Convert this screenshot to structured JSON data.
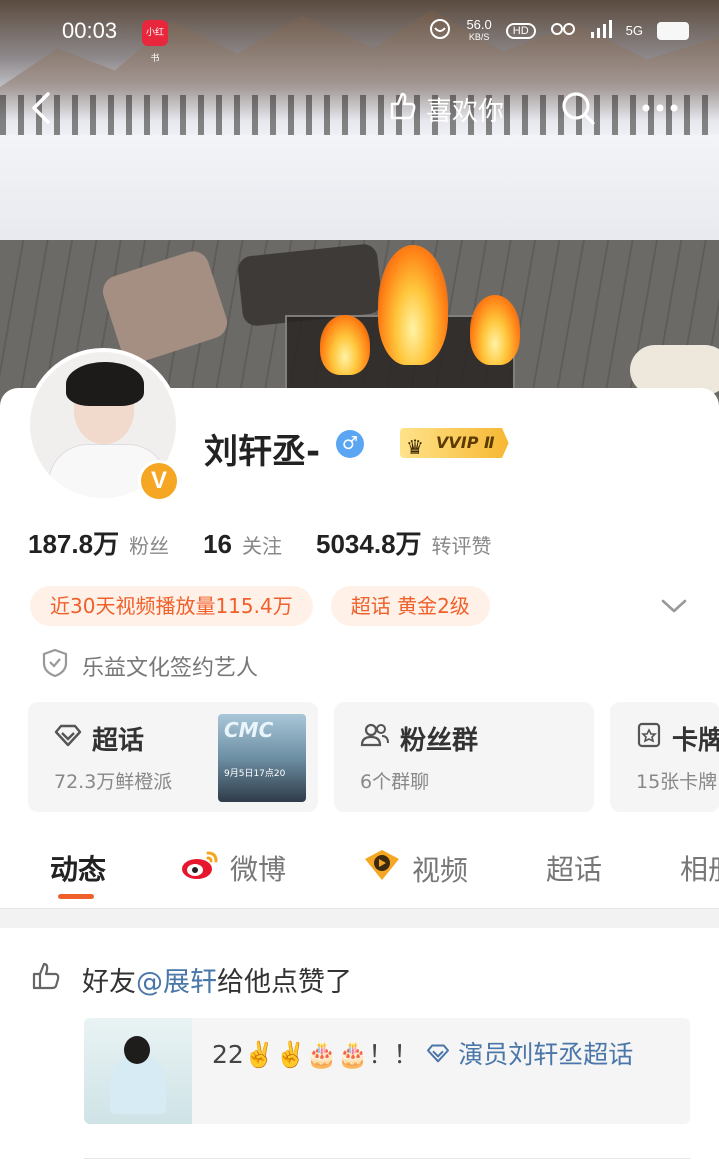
{
  "status_bar": {
    "time": "00:03",
    "app_badge": "小红书",
    "net_speed": "56.0",
    "net_unit": "KB/S",
    "hd_label": "HD",
    "signal_label": "5G"
  },
  "top_nav": {
    "like_label": "喜欢你"
  },
  "profile": {
    "name": "刘轩丞-",
    "gender_symbol": "♂",
    "vip_label": "VVIP Ⅱ",
    "verified_mark": "V",
    "stats": [
      {
        "value": "187.8万",
        "label": "粉丝"
      },
      {
        "value": "16",
        "label": "关注"
      },
      {
        "value": "5034.8万",
        "label": "转评赞"
      }
    ],
    "tags": [
      "近30天视频播放量115.4万",
      "超话 黄金2级"
    ],
    "contract": "乐益文化签约艺人"
  },
  "feature_cards": [
    {
      "title": "超话",
      "sub": "72.3万鲜橙派",
      "poster_title": "CMC",
      "poster_text": "9月5日17点20"
    },
    {
      "title": "粉丝群",
      "sub": "6个群聊"
    },
    {
      "title": "卡牌",
      "sub": "15张卡牌"
    }
  ],
  "tabs": [
    "动态",
    "微博",
    "视频",
    "超话",
    "相册"
  ],
  "active_tab": "动态",
  "feed": {
    "liked_prefix": "好友",
    "liked_user": "@展轩",
    "liked_suffix": "给他点赞了",
    "post_text": "22✌️✌️🎂🎂！！",
    "post_topic": "演员刘轩丞超话"
  },
  "colors": {
    "accent": "#f0602a",
    "link": "#4a76a8",
    "tag_bg": "#fff1e8",
    "gender_blue": "#5aa6f2",
    "vip_gold": "#f7b733"
  }
}
